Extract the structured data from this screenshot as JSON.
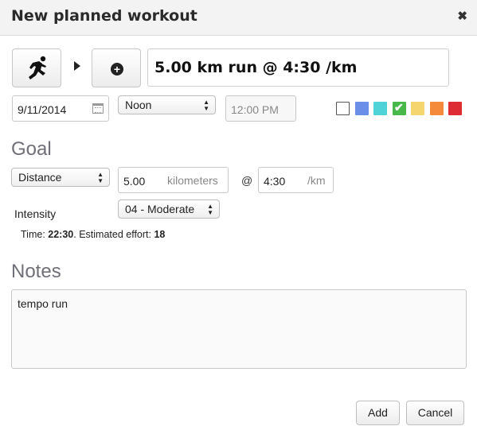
{
  "header": {
    "title": "New planned workout",
    "close_glyph": "✖"
  },
  "activity": {
    "icon": "running-person-icon"
  },
  "add_button": {
    "icon": "plus-circle-icon",
    "glyph": "+"
  },
  "workout_title": "5.00 km run @ 4:30 /km",
  "date": {
    "value": "9/11/2014",
    "icon": "calendar-icon"
  },
  "time_of_day": {
    "selected": "Noon"
  },
  "time": {
    "placeholder": "12:00 PM"
  },
  "colors": [
    {
      "hex": "#ffffff",
      "selected": false
    },
    {
      "hex": "#6b8ee8",
      "selected": false
    },
    {
      "hex": "#4fd3d8",
      "selected": false
    },
    {
      "hex": "#49b84a",
      "selected": true
    },
    {
      "hex": "#f5d66e",
      "selected": false
    },
    {
      "hex": "#f58a3a",
      "selected": false
    },
    {
      "hex": "#dd2c33",
      "selected": false
    }
  ],
  "goal": {
    "label": "Goal",
    "type_selected": "Distance",
    "distance_value": "5.00",
    "distance_unit": "kilometers",
    "at": "@",
    "pace_value": "4:30",
    "pace_unit": "/km"
  },
  "intensity": {
    "label": "Intensity",
    "selected": "04 - Moderate"
  },
  "summary": {
    "time_label": "Time:",
    "time_value": "22:30",
    "effort_label": ". Estimated effort:",
    "effort_value": "18"
  },
  "notes": {
    "label": "Notes",
    "value": "tempo run"
  },
  "footer": {
    "add_label": "Add",
    "cancel_label": "Cancel"
  }
}
